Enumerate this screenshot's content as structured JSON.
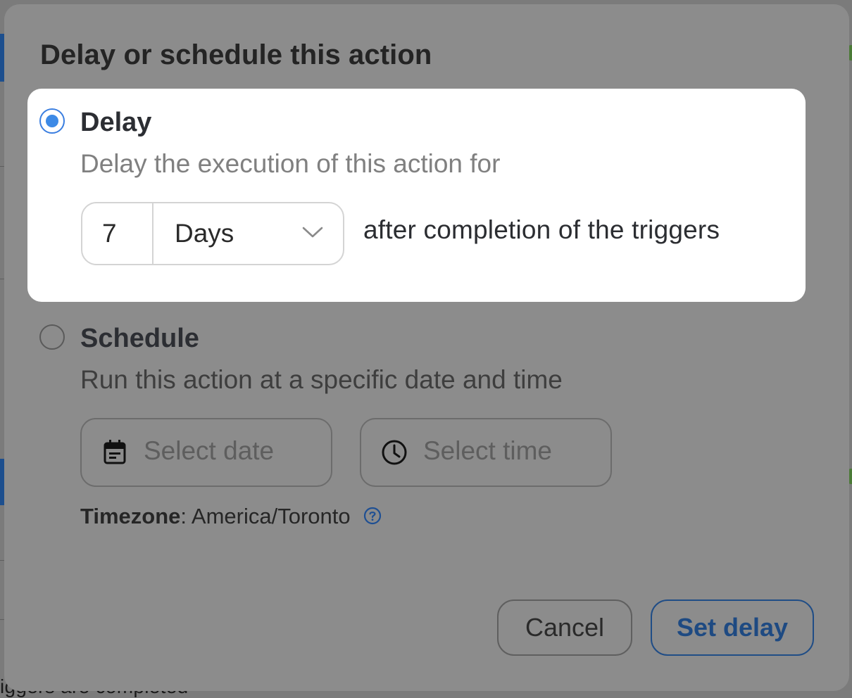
{
  "background": {
    "partial_text": "iggers are completed"
  },
  "modal": {
    "title": "Delay or schedule this action",
    "delay_option": {
      "selected": true,
      "label": "Delay",
      "description": "Delay the execution of this action for",
      "amount_value": "7",
      "unit_value": "Days",
      "suffix_text": "after completion of the triggers"
    },
    "schedule_option": {
      "selected": false,
      "label": "Schedule",
      "description": "Run this action at a specific date and time",
      "date_placeholder": "Select date",
      "time_placeholder": "Select time",
      "timezone_label": "Timezone",
      "timezone_value": "America/Toronto"
    },
    "buttons": {
      "cancel": "Cancel",
      "confirm": "Set delay"
    }
  },
  "icons": {
    "radio_selected": "radio-selected-icon",
    "radio_unselected": "radio-unselected-icon",
    "unit_dropdown": "chevron-down-icon",
    "date": "calendar-icon",
    "time": "clock-icon",
    "help": "help-icon"
  },
  "colors": {
    "accent": "#3d8ae6",
    "primary_button": "#1e4a82",
    "overlay": "#8c8c8c",
    "card": "#ffffff"
  }
}
